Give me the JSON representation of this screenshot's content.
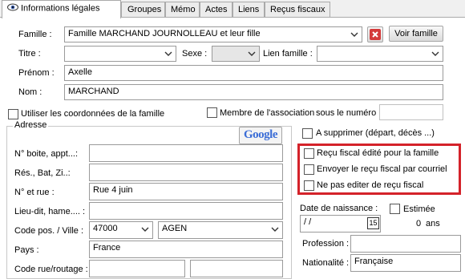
{
  "tabs": [
    {
      "label": "Informations légales",
      "active": true
    },
    {
      "label": "Groupes"
    },
    {
      "label": "Mémo"
    },
    {
      "label": "Actes"
    },
    {
      "label": "Liens"
    },
    {
      "label": "Reçus fiscaux"
    }
  ],
  "famille": {
    "label": "Famille :",
    "value": "Famille MARCHAND JOURNOLLEAU et leur fille",
    "voir_label": "Voir famille"
  },
  "titre": {
    "label": "Titre :",
    "value": ""
  },
  "sexe": {
    "label": "Sexe :",
    "value": ""
  },
  "lien_famille": {
    "label": "Lien famille :",
    "value": ""
  },
  "prenom": {
    "label": "Prénom :",
    "value": "Axelle"
  },
  "nom": {
    "label": "Nom :",
    "value": "MARCHAND"
  },
  "utiliser_coords_label": "Utiliser les coordonnées de la famille",
  "membre_label": "Membre de l'association",
  "sous_numero_label": "sous le numéro",
  "sous_numero_value": "",
  "adresse": {
    "legend": "Adresse",
    "google_label": "Google",
    "fields": [
      {
        "label": "N° boite, appt...:",
        "value": ""
      },
      {
        "label": "Rés., Bat, Zi..:",
        "value": ""
      },
      {
        "label": "N° et rue :",
        "value": "Rue 4 juin"
      },
      {
        "label": "Lieu-dit, hame.... :",
        "value": ""
      }
    ],
    "cp_label": "Code pos. / Ville :",
    "cp_value": "47000",
    "ville_value": "AGEN",
    "pays_label": "Pays :",
    "pays_value": "France",
    "code_rue_label": "Code rue/routage :"
  },
  "a_supprimer_label": "A supprimer (départ, décès ...)",
  "recu_options": [
    "Reçu fiscal édité pour la famille",
    "Envoyer le reçu fiscal par courriel",
    "Ne pas editer de reçu fiscal"
  ],
  "date_naissance": {
    "label": "Date de naissance :",
    "value": " / /",
    "estimee_label": "Estimée",
    "age_value": "0",
    "age_unit": "ans"
  },
  "profession": {
    "label": "Profession :",
    "value": ""
  },
  "nationalite": {
    "label": "Nationalité :",
    "value": "Française"
  },
  "colors": {
    "highlight": "#d4222a",
    "delete": "#d43a3a"
  }
}
